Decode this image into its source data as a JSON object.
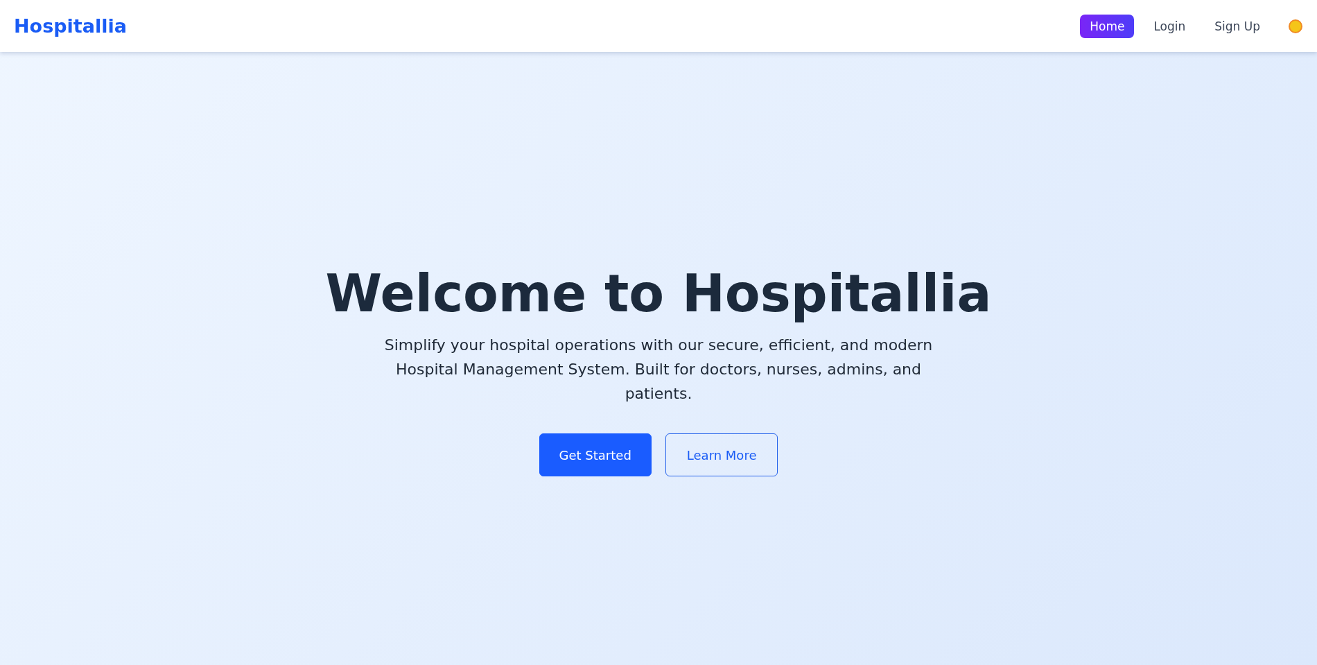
{
  "brand": "Hospitallia",
  "nav": [
    {
      "label": "Home",
      "selected": true
    },
    {
      "label": "Login",
      "selected": false
    },
    {
      "label": "Sign Up",
      "selected": false
    }
  ],
  "hero": {
    "title": "Welcome to Hospitallia",
    "subtitle": "Simplify your hospital operations with our secure, efficient, and modern Hospital Management System. Built for doctors, nurses, admins, and patients.",
    "buttons": [
      {
        "label": "Get Started",
        "kind": "primary"
      },
      {
        "label": "Learn More",
        "kind": "outline"
      }
    ]
  }
}
